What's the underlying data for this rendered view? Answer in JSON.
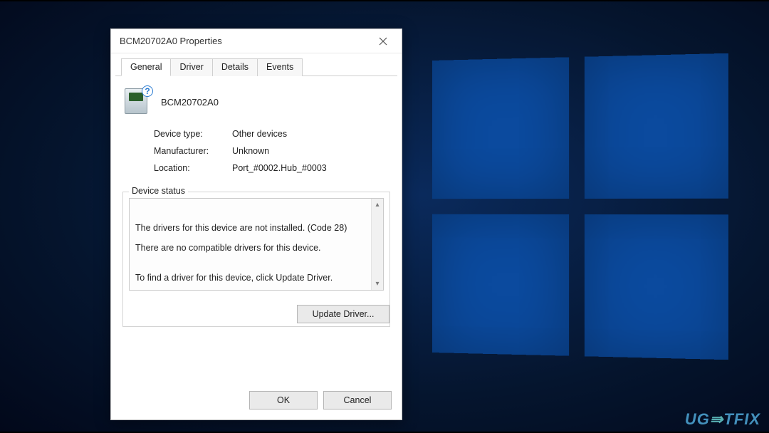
{
  "watermark": "UGETFIX",
  "dialog": {
    "title": "BCM20702A0 Properties",
    "device_name": "BCM20702A0",
    "tabs": [
      {
        "label": "General",
        "active": true
      },
      {
        "label": "Driver",
        "active": false
      },
      {
        "label": "Details",
        "active": false
      },
      {
        "label": "Events",
        "active": false
      }
    ],
    "fields": {
      "device_type_label": "Device type:",
      "device_type_value": "Other devices",
      "manufacturer_label": "Manufacturer:",
      "manufacturer_value": "Unknown",
      "location_label": "Location:",
      "location_value": "Port_#0002.Hub_#0003"
    },
    "status": {
      "legend": "Device status",
      "text": "The drivers for this device are not installed. (Code 28)\n\nThere are no compatible drivers for this device.\n\n\nTo find a driver for this device, click Update Driver."
    },
    "buttons": {
      "update_driver": "Update Driver...",
      "ok": "OK",
      "cancel": "Cancel"
    }
  }
}
